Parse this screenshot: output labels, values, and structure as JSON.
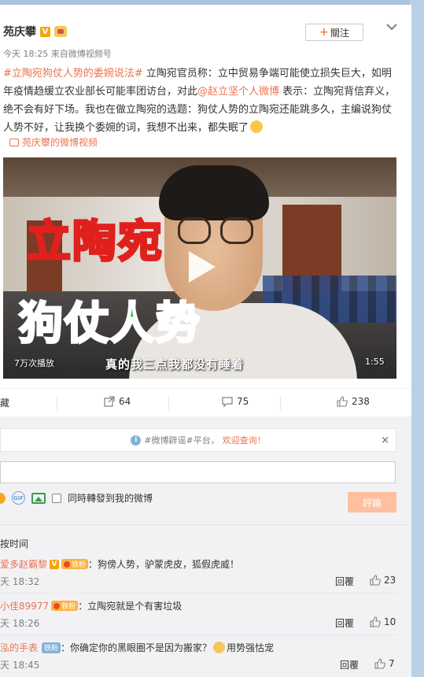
{
  "post": {
    "author": "苑庆攀",
    "v_badge": "V",
    "time": "今天 18:25",
    "source": "来自微博视频号",
    "follow_label": "關注",
    "text_tag": "#立陶宛狗仗人势的委婉说法#",
    "text_part1": " 立陶宛官员称：立中贸易争端可能使立损失巨大，如明年疫情趋缓立农业部长可能率团访台，对此",
    "text_mention": "@赵立坚个人微博",
    "text_part2": " 表示：立陶宛背信弃义，绝不会有好下场。我也在做立陶宛的选题：狗仗人势的立陶宛还能跳多久，主编说狗仗人势不好，让我换个委婉的词，我想不出来，都失眠了",
    "video_link": "苑庆攀的微博视频"
  },
  "video": {
    "title_line1": "立陶宛",
    "title_line2": "狗仗人势",
    "subtitle": "真的我三点我都没有睡着",
    "views": "7万次播放",
    "duration": "1:55"
  },
  "actions": {
    "favorite": "收藏",
    "repost_count": "64",
    "comment_count": "75",
    "like_count": "238"
  },
  "notice": {
    "text_prefix": "#微博辟谣#平台，",
    "text_highlight": "欢迎查询！",
    "close": "×"
  },
  "composer": {
    "repost_option": "同時轉發到我的微博",
    "submit_label": "評論",
    "gif_label": "GIF"
  },
  "sort_label": "按时间",
  "comments": [
    {
      "user": "爱多赵霸黎",
      "badge": "铁粉",
      "text": "：狗傍人势，驴蒙虎皮，狐假虎威！",
      "time": "天 18:32",
      "reply": "回覆",
      "likes": "23"
    },
    {
      "user": "小佳89977",
      "badge": "铁粉",
      "text": "：立陶宛就是个有害垃圾",
      "time": "天 18:26",
      "reply": "回覆",
      "likes": "10"
    },
    {
      "user": "泓的手表",
      "badge": "铁粉",
      "text_a": "：你确定你的黑眼圈不是因为搬家？",
      "text_b": "用势强怙宠",
      "time": "天 18:45",
      "reply": "回覆",
      "likes": "7"
    }
  ],
  "colors": {
    "accent": "#eb7350",
    "background": "#a9c4dc",
    "submit_disabled": "#ffc09f"
  }
}
